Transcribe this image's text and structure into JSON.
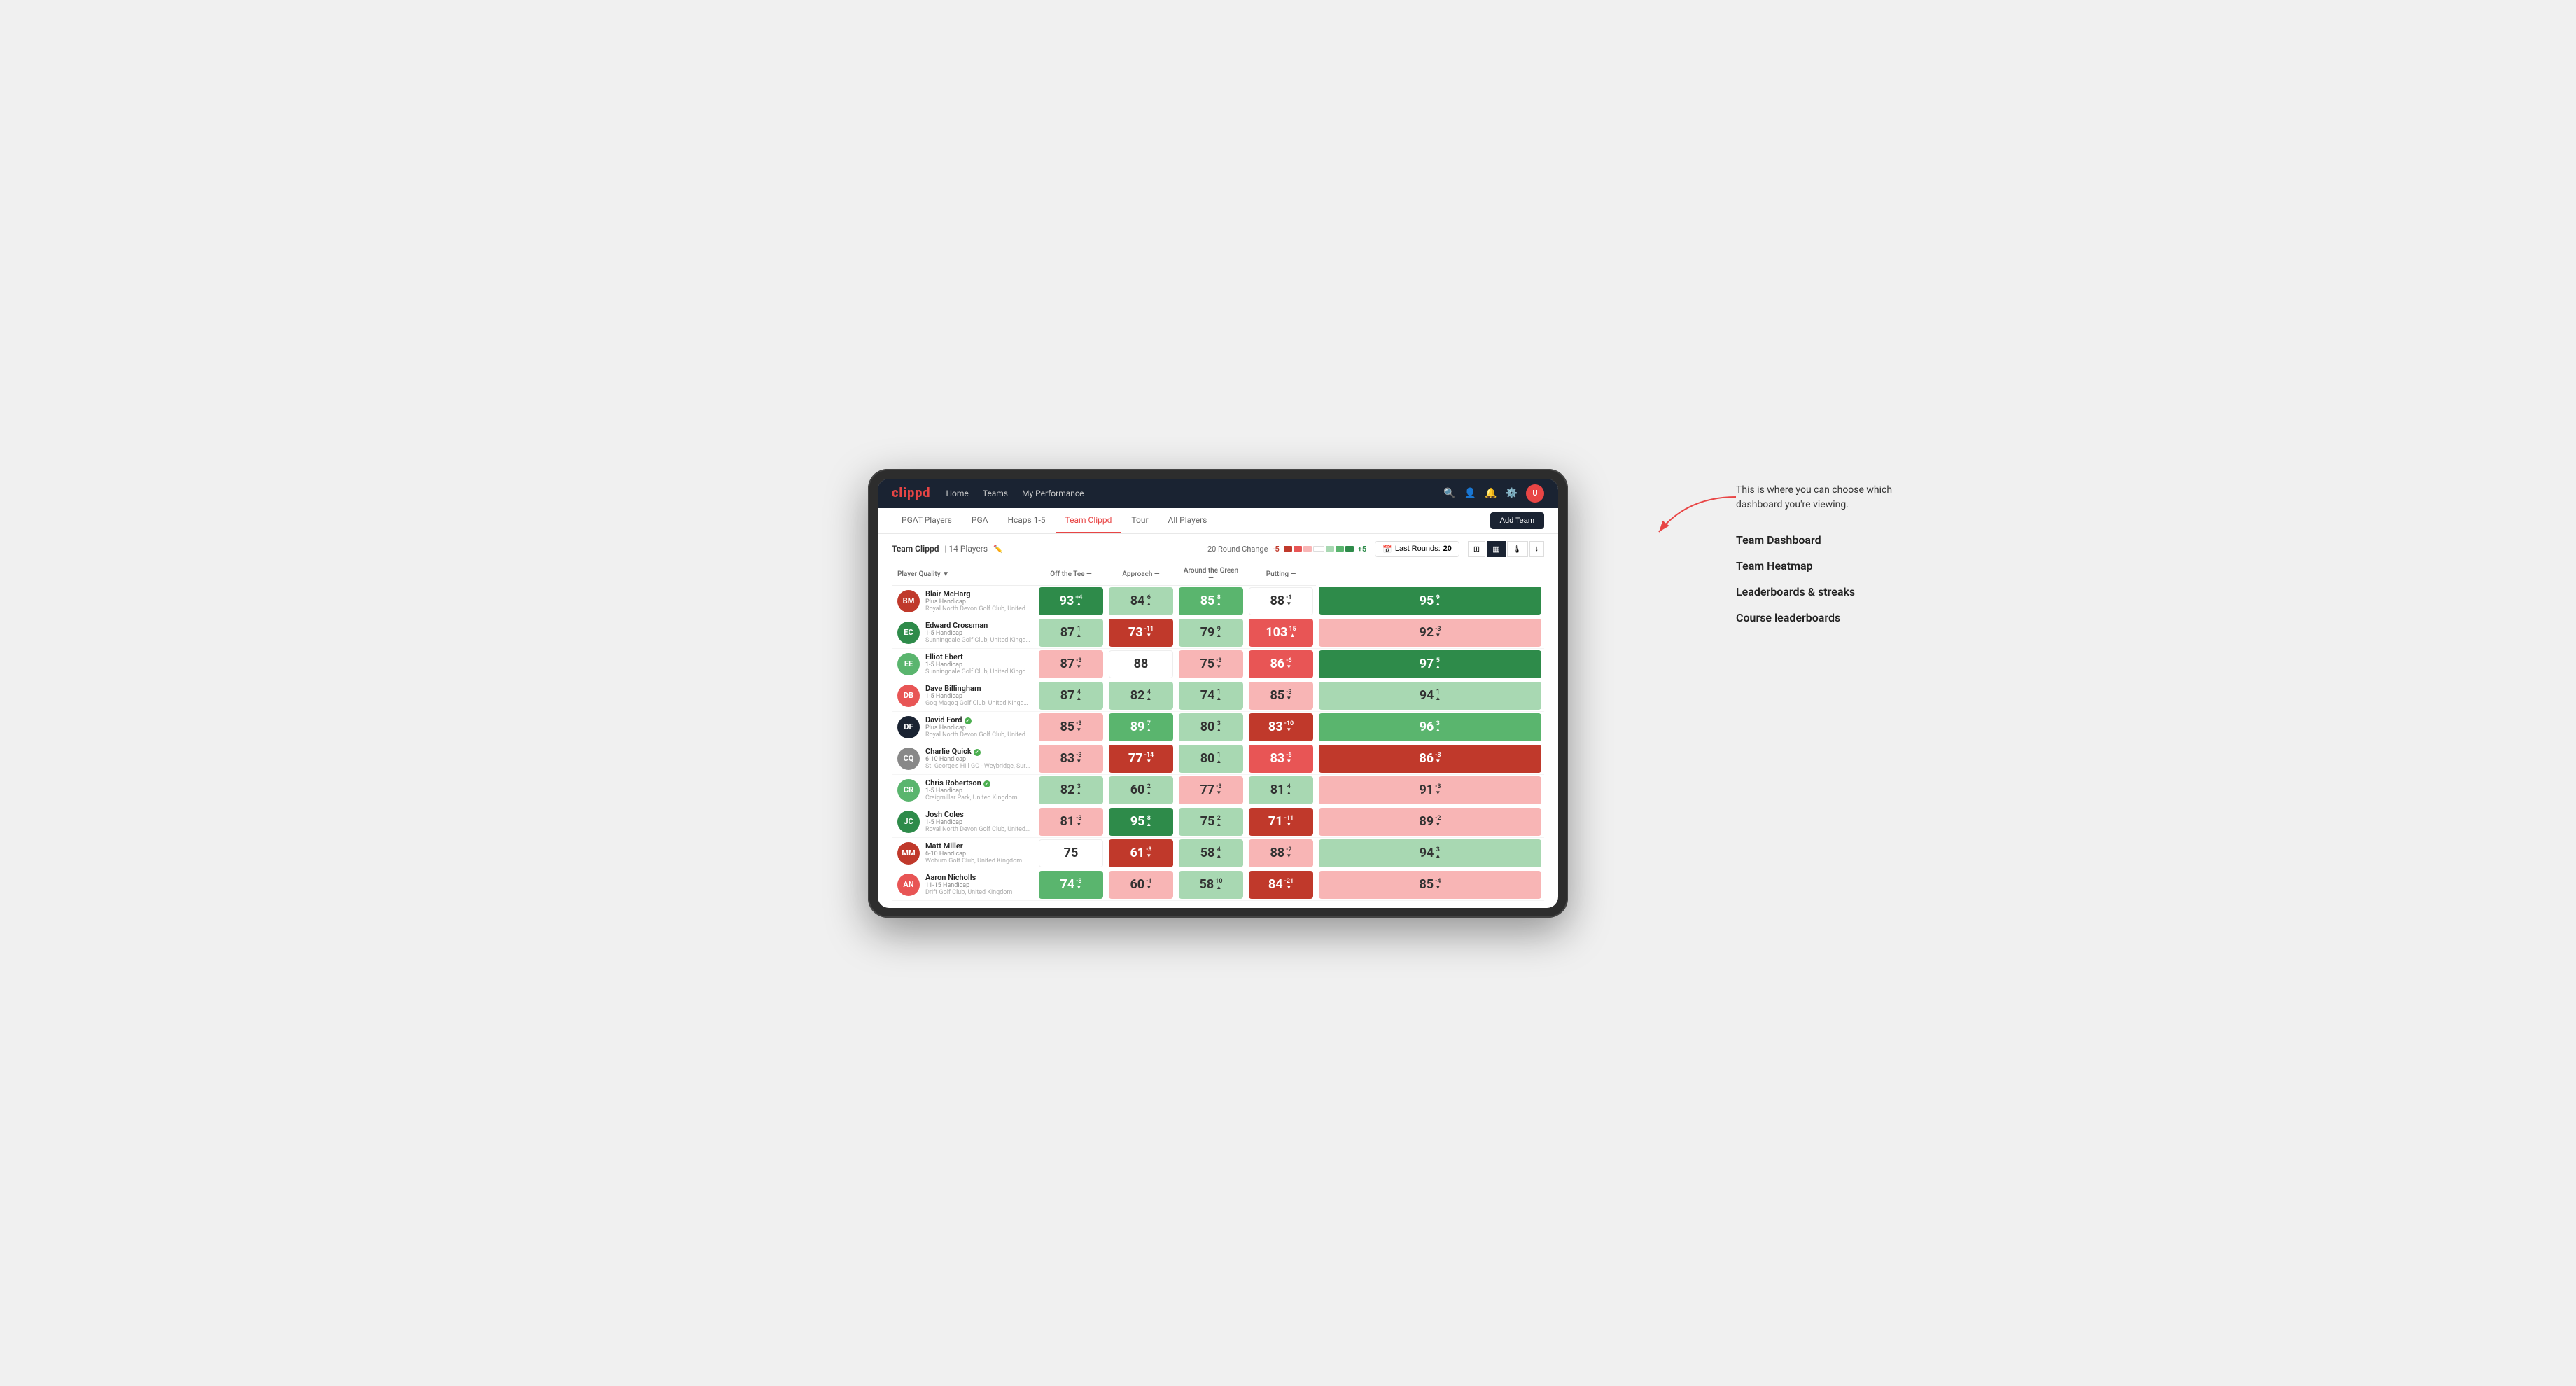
{
  "annotation": {
    "intro": "This is where you can choose which dashboard you're viewing.",
    "items": [
      "Team Dashboard",
      "Team Heatmap",
      "Leaderboards & streaks",
      "Course leaderboards"
    ]
  },
  "nav": {
    "logo": "clippd",
    "links": [
      "Home",
      "Teams",
      "My Performance"
    ],
    "icons": [
      "search",
      "person",
      "bell",
      "settings",
      "avatar"
    ]
  },
  "subnav": {
    "tabs": [
      "PGAT Players",
      "PGA",
      "Hcaps 1-5",
      "Team Clippd",
      "Tour",
      "All Players"
    ],
    "active": "Team Clippd",
    "add_button": "Add Team"
  },
  "team_bar": {
    "team_name": "Team Clippd",
    "player_count": "14 Players",
    "round_change_label": "20 Round Change",
    "range_low": "-5",
    "range_high": "+5",
    "last_rounds_label": "Last Rounds:",
    "last_rounds_value": "20"
  },
  "table": {
    "columns": {
      "player": "Player Quality ▼",
      "off_tee": "Off the Tee —",
      "approach": "Approach —",
      "around_green": "Around the Green —",
      "putting": "Putting —"
    },
    "players": [
      {
        "name": "Blair McHarg",
        "handicap": "Plus Handicap",
        "club": "Royal North Devon Golf Club, United Kingdom",
        "scores": {
          "quality": {
            "val": 93,
            "delta": "+4",
            "dir": "up",
            "bg": "green-dark"
          },
          "off_tee": {
            "val": 84,
            "delta": "6",
            "dir": "up",
            "bg": "green-light"
          },
          "approach": {
            "val": 85,
            "delta": "8",
            "dir": "up",
            "bg": "green-mid"
          },
          "around": {
            "val": 88,
            "delta": "-1",
            "dir": "down",
            "bg": "white"
          },
          "putting": {
            "val": 95,
            "delta": "9",
            "dir": "up",
            "bg": "green-dark"
          }
        }
      },
      {
        "name": "Edward Crossman",
        "handicap": "1-5 Handicap",
        "club": "Sunningdale Golf Club, United Kingdom",
        "scores": {
          "quality": {
            "val": 87,
            "delta": "1",
            "dir": "up",
            "bg": "green-light"
          },
          "off_tee": {
            "val": 73,
            "delta": "-11",
            "dir": "down",
            "bg": "red-dark"
          },
          "approach": {
            "val": 79,
            "delta": "9",
            "dir": "up",
            "bg": "green-light"
          },
          "around": {
            "val": 103,
            "delta": "15",
            "dir": "up",
            "bg": "red-mid"
          },
          "putting": {
            "val": 92,
            "delta": "-3",
            "dir": "down",
            "bg": "red-light"
          }
        }
      },
      {
        "name": "Elliot Ebert",
        "handicap": "1-5 Handicap",
        "club": "Sunningdale Golf Club, United Kingdom",
        "scores": {
          "quality": {
            "val": 87,
            "delta": "-3",
            "dir": "down",
            "bg": "red-light"
          },
          "off_tee": {
            "val": 88,
            "delta": "",
            "dir": "",
            "bg": "white"
          },
          "approach": {
            "val": 75,
            "delta": "-3",
            "dir": "down",
            "bg": "red-light"
          },
          "around": {
            "val": 86,
            "delta": "-6",
            "dir": "down",
            "bg": "red-mid"
          },
          "putting": {
            "val": 97,
            "delta": "5",
            "dir": "up",
            "bg": "green-dark"
          }
        }
      },
      {
        "name": "Dave Billingham",
        "handicap": "1-5 Handicap",
        "club": "Gog Magog Golf Club, United Kingdom",
        "scores": {
          "quality": {
            "val": 87,
            "delta": "4",
            "dir": "up",
            "bg": "green-light"
          },
          "off_tee": {
            "val": 82,
            "delta": "4",
            "dir": "up",
            "bg": "green-light"
          },
          "approach": {
            "val": 74,
            "delta": "1",
            "dir": "up",
            "bg": "green-light"
          },
          "around": {
            "val": 85,
            "delta": "-3",
            "dir": "down",
            "bg": "red-light"
          },
          "putting": {
            "val": 94,
            "delta": "1",
            "dir": "up",
            "bg": "green-light"
          }
        }
      },
      {
        "name": "David Ford",
        "handicap": "Plus Handicap",
        "club": "Royal North Devon Golf Club, United Kingdom",
        "verified": true,
        "scores": {
          "quality": {
            "val": 85,
            "delta": "-3",
            "dir": "down",
            "bg": "red-light"
          },
          "off_tee": {
            "val": 89,
            "delta": "7",
            "dir": "up",
            "bg": "green-mid"
          },
          "approach": {
            "val": 80,
            "delta": "3",
            "dir": "up",
            "bg": "green-light"
          },
          "around": {
            "val": 83,
            "delta": "-10",
            "dir": "down",
            "bg": "red-dark"
          },
          "putting": {
            "val": 96,
            "delta": "3",
            "dir": "up",
            "bg": "green-mid"
          }
        }
      },
      {
        "name": "Charlie Quick",
        "handicap": "6-10 Handicap",
        "club": "St. George's Hill GC - Weybridge, Surrey, United Kingdom",
        "verified": true,
        "scores": {
          "quality": {
            "val": 83,
            "delta": "-3",
            "dir": "down",
            "bg": "red-light"
          },
          "off_tee": {
            "val": 77,
            "delta": "-14",
            "dir": "down",
            "bg": "red-dark"
          },
          "approach": {
            "val": 80,
            "delta": "1",
            "dir": "up",
            "bg": "green-light"
          },
          "around": {
            "val": 83,
            "delta": "-6",
            "dir": "down",
            "bg": "red-mid"
          },
          "putting": {
            "val": 86,
            "delta": "-8",
            "dir": "down",
            "bg": "red-dark"
          }
        }
      },
      {
        "name": "Chris Robertson",
        "handicap": "1-5 Handicap",
        "club": "Craigmillar Park, United Kingdom",
        "verified": true,
        "scores": {
          "quality": {
            "val": 82,
            "delta": "3",
            "dir": "up",
            "bg": "green-light"
          },
          "off_tee": {
            "val": 60,
            "delta": "2",
            "dir": "up",
            "bg": "green-light"
          },
          "approach": {
            "val": 77,
            "delta": "-3",
            "dir": "down",
            "bg": "red-light"
          },
          "around": {
            "val": 81,
            "delta": "4",
            "dir": "up",
            "bg": "green-light"
          },
          "putting": {
            "val": 91,
            "delta": "-3",
            "dir": "down",
            "bg": "red-light"
          }
        }
      },
      {
        "name": "Josh Coles",
        "handicap": "1-5 Handicap",
        "club": "Royal North Devon Golf Club, United Kingdom",
        "scores": {
          "quality": {
            "val": 81,
            "delta": "-3",
            "dir": "down",
            "bg": "red-light"
          },
          "off_tee": {
            "val": 95,
            "delta": "8",
            "dir": "up",
            "bg": "green-dark"
          },
          "approach": {
            "val": 75,
            "delta": "2",
            "dir": "up",
            "bg": "green-light"
          },
          "around": {
            "val": 71,
            "delta": "-11",
            "dir": "down",
            "bg": "red-dark"
          },
          "putting": {
            "val": 89,
            "delta": "-2",
            "dir": "down",
            "bg": "red-light"
          }
        }
      },
      {
        "name": "Matt Miller",
        "handicap": "6-10 Handicap",
        "club": "Woburn Golf Club, United Kingdom",
        "scores": {
          "quality": {
            "val": 75,
            "delta": "",
            "dir": "",
            "bg": "white"
          },
          "off_tee": {
            "val": 61,
            "delta": "-3",
            "dir": "down",
            "bg": "red-dark"
          },
          "approach": {
            "val": 58,
            "delta": "4",
            "dir": "up",
            "bg": "green-light"
          },
          "around": {
            "val": 88,
            "delta": "-2",
            "dir": "down",
            "bg": "red-light"
          },
          "putting": {
            "val": 94,
            "delta": "3",
            "dir": "up",
            "bg": "green-light"
          }
        }
      },
      {
        "name": "Aaron Nicholls",
        "handicap": "11-15 Handicap",
        "club": "Drift Golf Club, United Kingdom",
        "scores": {
          "quality": {
            "val": 74,
            "delta": "-8",
            "dir": "down",
            "bg": "green-mid"
          },
          "off_tee": {
            "val": 60,
            "delta": "-1",
            "dir": "down",
            "bg": "red-light"
          },
          "approach": {
            "val": 58,
            "delta": "10",
            "dir": "up",
            "bg": "green-light"
          },
          "around": {
            "val": 84,
            "delta": "-21",
            "dir": "down",
            "bg": "red-dark"
          },
          "putting": {
            "val": 85,
            "delta": "-4",
            "dir": "down",
            "bg": "red-light"
          }
        }
      }
    ]
  },
  "colors": {
    "green_dark": "#2e8b4a",
    "green_mid": "#5ab56e",
    "green_light": "#a8d8b2",
    "white": "#ffffff",
    "red_light": "#f8b5b5",
    "red_mid": "#e85555",
    "red_dark": "#c0392b",
    "nav_bg": "#1a2332",
    "brand": "#e84545"
  }
}
